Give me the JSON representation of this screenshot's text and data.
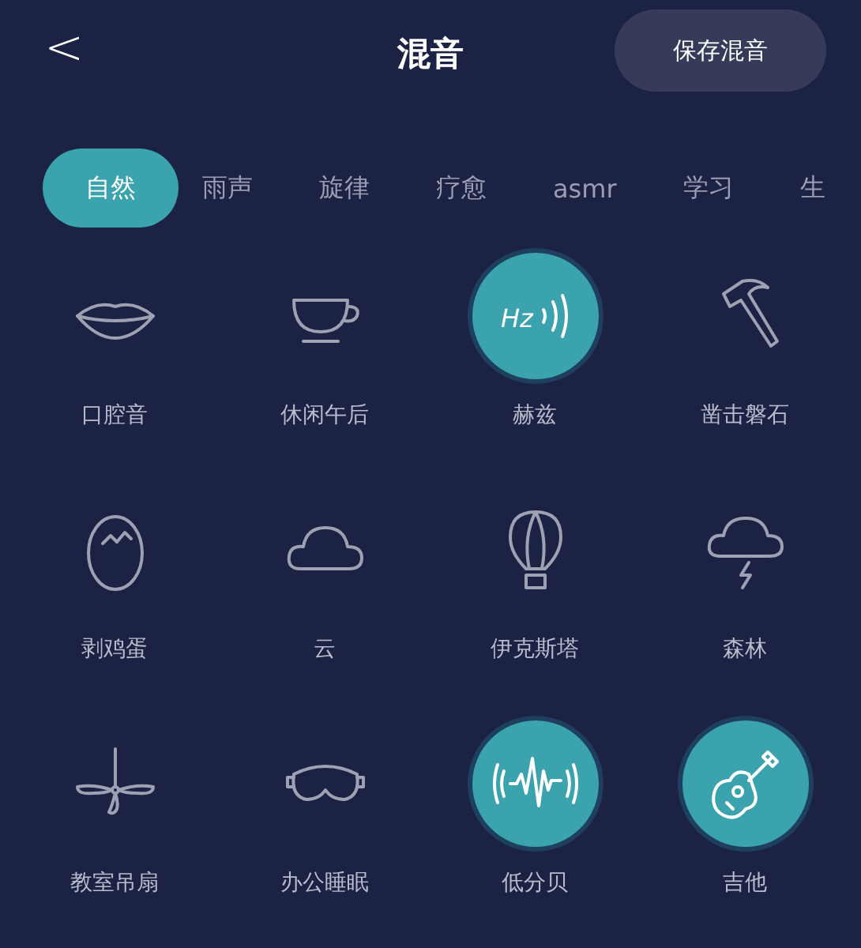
{
  "header": {
    "back": "<",
    "title": "混音",
    "save_button": "保存混音"
  },
  "tabs": [
    {
      "label": "自然",
      "selected": true
    },
    {
      "label": "雨声",
      "selected": false
    },
    {
      "label": "旋律",
      "selected": false
    },
    {
      "label": "疗愈",
      "selected": false
    },
    {
      "label": "asmr",
      "selected": false
    },
    {
      "label": "学习",
      "selected": false
    },
    {
      "label": "生",
      "selected": false
    }
  ],
  "sounds": [
    {
      "label": "口腔音",
      "selected": false
    },
    {
      "label": "休闲午后",
      "selected": false
    },
    {
      "label": "赫兹",
      "selected": true,
      "icon_text": "Hz"
    },
    {
      "label": "凿击磐石",
      "selected": false
    },
    {
      "label": "剥鸡蛋",
      "selected": false
    },
    {
      "label": "云",
      "selected": false
    },
    {
      "label": "伊克斯塔",
      "selected": false
    },
    {
      "label": "森林",
      "selected": false
    },
    {
      "label": "教室吊扇",
      "selected": false
    },
    {
      "label": "办公睡眠",
      "selected": false
    },
    {
      "label": "低分贝",
      "selected": true
    },
    {
      "label": "吉他",
      "selected": true
    }
  ]
}
